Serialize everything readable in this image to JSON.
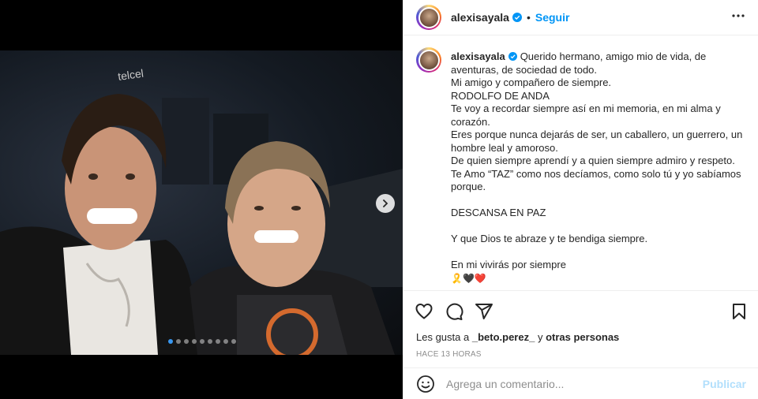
{
  "post": {
    "username": "alexisayala",
    "follow_label": "Seguir",
    "separator": "•",
    "caption_lines": [
      "Querido hermano, amigo mio de vida, de aventuras, de sociedad de todo.",
      "Mi amigo y compañero de siempre.",
      "RODOLFO DE ANDA",
      "Te voy a recordar siempre así en mi memoria, en mi alma y corazón.",
      "Eres porque nunca dejarás de ser, un caballero, un guerrero, un hombre leal y amoroso.",
      "De quien siempre aprendí y a quien siempre admiro y respeto.",
      "Te Amo “TAZ” como nos decíamos, como solo tú y yo sabíamos porque.",
      "",
      "DESCANSA EN PAZ",
      "",
      "Y que Dios te abraze y te bendiga siempre.",
      "",
      "En mi vivirás por siempre"
    ],
    "caption_emojis": "🎗️🖤❤️",
    "likes_prefix": "Les gusta a",
    "likes_user": "_beto.perez_",
    "likes_connector": "y",
    "likes_others": "otras personas",
    "time_label": "HACE 13 HORAS",
    "photo_sign_text": "telcel"
  },
  "comment": {
    "placeholder": "Agrega un comentario...",
    "publish_label": "Publicar"
  },
  "carousel": {
    "total_slides": 9,
    "active_index": 0
  },
  "colors": {
    "accent": "#0095f6",
    "publish_disabled": "#b2dffc",
    "muted": "#8e8e8e",
    "carousel_active_dot": "#3897f0"
  },
  "icons": {
    "verified": "verified-badge-icon",
    "more": "more-horizontal-icon",
    "like": "heart-icon",
    "comment": "comment-bubble-icon",
    "share": "paper-plane-icon",
    "save": "bookmark-icon",
    "emoji": "smiley-icon",
    "next": "chevron-right-icon"
  }
}
